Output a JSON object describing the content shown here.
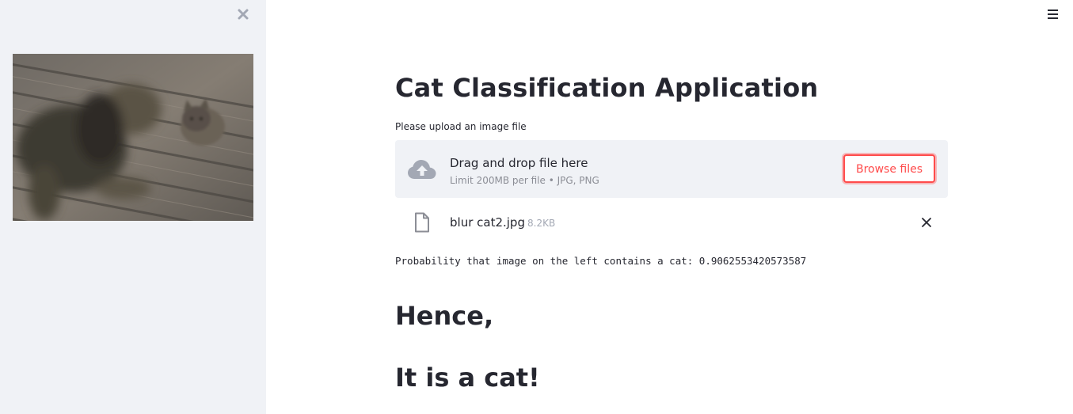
{
  "sidebar": {
    "close_icon": "close-icon",
    "image_alt": "blurred photo of two kittens on wooden deck"
  },
  "header": {
    "menu_icon": "hamburger-menu-icon"
  },
  "main": {
    "title": "Cat Classification Application",
    "uploader": {
      "label": "Please upload an image file",
      "drop_text": "Drag and drop file here",
      "limit_text": "Limit 200MB per file • JPG, PNG",
      "browse_label": "Browse files",
      "upload_icon": "cloud-upload-icon"
    },
    "file": {
      "name": "blur cat2.jpg",
      "size": "8.2KB",
      "file_icon": "file-icon",
      "remove_icon": "close-icon"
    },
    "probability_text": "Probability that image on the left contains a cat: 0.9062553420573587",
    "hence_text": "Hence,",
    "verdict_text": "It is a cat!"
  },
  "colors": {
    "sidebar_bg": "#f0f2f6",
    "accent": "#ff4b4b",
    "text": "#262730",
    "muted": "#8c8e96"
  }
}
